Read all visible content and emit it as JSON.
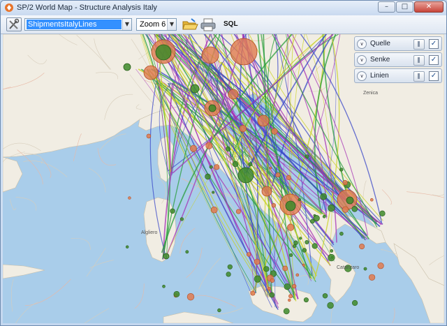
{
  "window": {
    "title": "SP/2 World Map - Structure Analysis Italy",
    "controls": [
      "minimize",
      "maximize",
      "close"
    ]
  },
  "toolbar": {
    "layer_select": {
      "value": "ShipmentsItalyLines"
    },
    "zoom_select": {
      "value": "Zoom 6"
    },
    "sql_label": "SQL",
    "icons": [
      "tools-icon",
      "folder-open-icon",
      "printer-icon"
    ]
  },
  "legend": [
    {
      "label": "Quelle",
      "checked": true
    },
    {
      "label": "Senke",
      "checked": true
    },
    {
      "label": "Linien",
      "checked": true
    }
  ],
  "map": {
    "colors": {
      "sea": "#a9cdea",
      "land": "#f1ede3",
      "source": "#e07a4f",
      "sink": "#3e8a2a",
      "lines": [
        "#3a47c8",
        "#c8d21c",
        "#a632b6",
        "#2a9e3c"
      ]
    },
    "labels": [
      "Zenica",
      "Catanzaro",
      "Algliero"
    ]
  }
}
